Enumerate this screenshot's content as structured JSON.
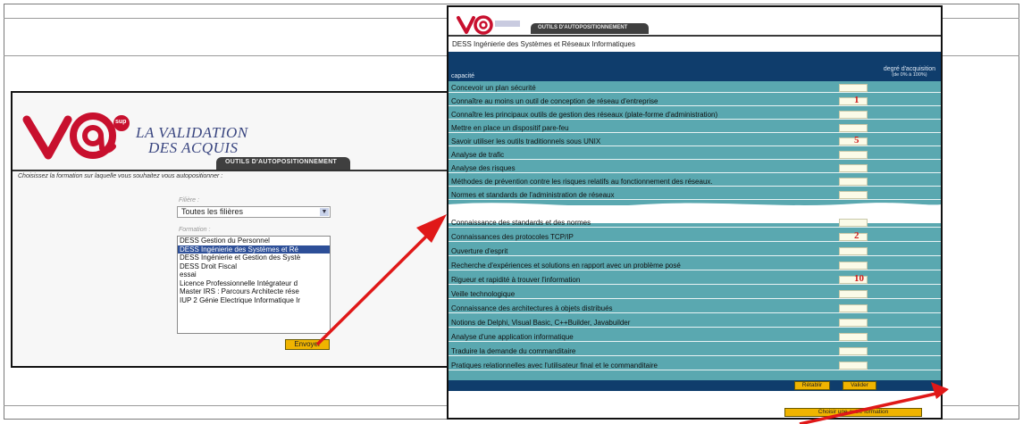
{
  "left": {
    "brand_line1": "LA VALIDATION",
    "brand_line2": "DES ACQUIS",
    "brand_badge": "sup",
    "tab_label": "OUTILS D'AUTOPOSITIONNEMENT",
    "instruction": "Choisissez la formation sur laquelle vous souhaitez vous autopositionner :",
    "filiere_label": "Filière :",
    "filiere_value": "Toutes les filières",
    "formation_label": "Formation :",
    "formations": [
      "DESS Gestion du Personnel",
      "DESS Ingénierie des Systèmes et Ré",
      "DESS Ingénierie et Gestion des Systè",
      "DESS Droit Fiscal",
      "essai",
      "Licence Professionnelle Intégrateur d",
      "Master IRS : Parcours Architecte rése",
      "IUP 2 Génie Electrique Informatique Ir"
    ],
    "selected_index": 1,
    "send_button": "Envoyer"
  },
  "right": {
    "tab_label": "OUTILS D'AUTOPOSITIONNEMENT",
    "title": "DESS Ingénierie des Systèmes et Réseaux Informatiques",
    "header_capacite": "capacité",
    "header_degre": "degré d'acquisition",
    "header_degre_sub": "(de 0% à 100%)",
    "rows_top": [
      {
        "label": "Concevoir un plan sécurité",
        "value": ""
      },
      {
        "label": "Connaître au moins un outil de conception de réseau d'entreprise",
        "value": "1"
      },
      {
        "label": "Connaître les principaux outils de gestion des réseaux (plate-forme d'administration)",
        "value": ""
      },
      {
        "label": "Mettre en place un dispositif pare-feu",
        "value": ""
      },
      {
        "label": "Savoir utiliser les outils traditionnels sous UNIX",
        "value": "5"
      },
      {
        "label": "Analyse de trafic",
        "value": ""
      },
      {
        "label": "Analyse des risques",
        "value": ""
      },
      {
        "label": "Méthodes de prévention contre les risques relatifs au fonctionnement des réseaux.",
        "value": ""
      },
      {
        "label": "Normes et standards de l'administration de réseaux",
        "value": ""
      }
    ],
    "rows_bottom": [
      {
        "label": "Connaissance des standards et des normes",
        "value": ""
      },
      {
        "label": "Connaissances des protocoles TCP/IP",
        "value": "2"
      },
      {
        "label": "Ouverture d'esprit",
        "value": ""
      },
      {
        "label": "Recherche d'expériences et solutions en rapport avec un problème posé",
        "value": ""
      },
      {
        "label": "Rigueur et rapidité à trouver l'information",
        "value": "10"
      },
      {
        "label": "Veille technologique",
        "value": ""
      },
      {
        "label": "Connaissance des architectures à objets distribués",
        "value": ""
      },
      {
        "label": "Notions de Delphi, Visual Basic, C++Builder, Javabuilder",
        "value": ""
      },
      {
        "label": "Analyse d'une application informatique",
        "value": ""
      },
      {
        "label": "Traduire la demande du commanditaire",
        "value": ""
      },
      {
        "label": "Pratiques relationnelles avec l'utilisateur final et le commanditaire",
        "value": ""
      }
    ],
    "reset_button": "Rétablir",
    "validate_button": "Valider",
    "choose_button": "Choisir une autre formation"
  },
  "colors": {
    "header_navy": "#0f3d6c",
    "table_teal": "#5aa8b0",
    "button_yellow": "#f0b400",
    "arrow_red": "#e01818",
    "selection_blue": "#2d4f98"
  }
}
